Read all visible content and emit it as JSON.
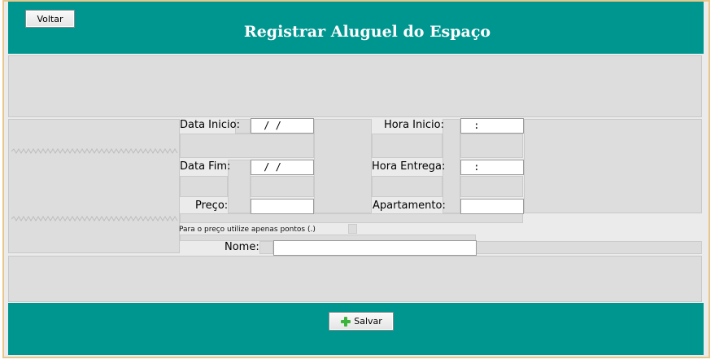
{
  "header": {
    "title": "Registrar Aluguel do Espaço",
    "back_button": "Voltar"
  },
  "form": {
    "data_inicio": {
      "label": "Data Inicio:",
      "value": " / /"
    },
    "data_fim": {
      "label": "Data Fim:",
      "value": " / /"
    },
    "preco": {
      "label": "Preço:",
      "value": ""
    },
    "hora_inicio": {
      "label": "Hora Inicio:",
      "value": " :"
    },
    "hora_entrega": {
      "label": "Hora Entrega:",
      "value": " :"
    },
    "apartamento": {
      "label": "Apartamento:",
      "value": ""
    },
    "hint": "Para o preço utilize apenas pontos (.)",
    "nome": {
      "label": "Nome:",
      "value": ""
    }
  },
  "footer": {
    "save_button": "Salvar",
    "save_icon": "plus-icon",
    "save_icon_color": "#3cb43c"
  },
  "colors": {
    "header_bg": "#009690",
    "frame_border": "#e8c88a"
  }
}
